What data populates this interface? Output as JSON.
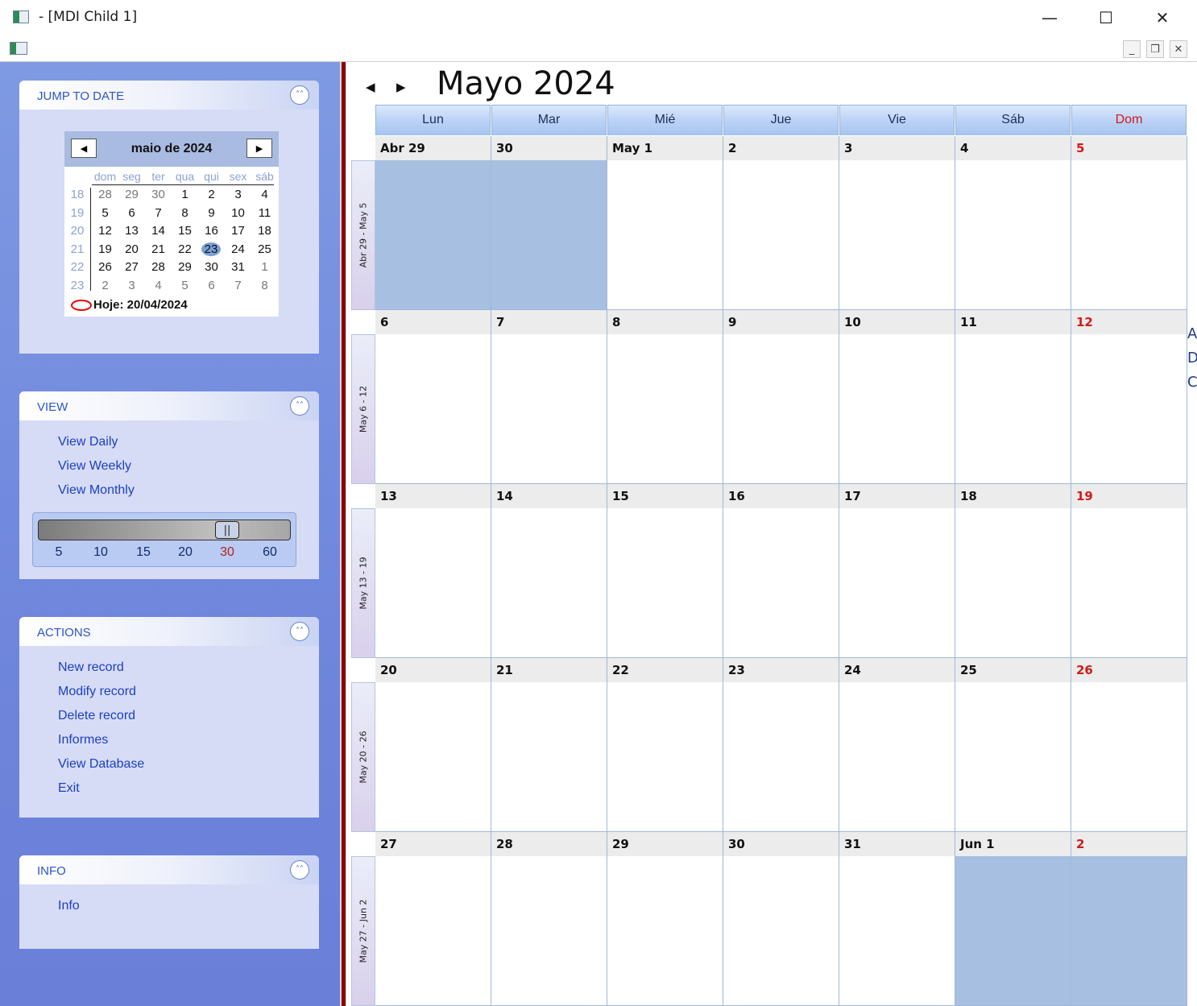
{
  "window": {
    "title": " - [MDI Child 1]",
    "minimize_icon": "—",
    "maximize_icon": "☐",
    "close_icon": "✕"
  },
  "mdi": {
    "min": "_",
    "restore": "❒",
    "close": "✕"
  },
  "sidebar": {
    "jump": {
      "title": "JUMP TO DATE",
      "collapse_icon": "˄˄",
      "minical": {
        "title": "maio de 2024",
        "prev": "◀",
        "next": "▶",
        "dow": [
          "dom",
          "seg",
          "ter",
          "qua",
          "qui",
          "sex",
          "sáb"
        ],
        "weeks": [
          {
            "wk": "18",
            "days": [
              "28",
              "29",
              "30",
              "1",
              "2",
              "3",
              "4"
            ]
          },
          {
            "wk": "19",
            "days": [
              "5",
              "6",
              "7",
              "8",
              "9",
              "10",
              "11"
            ]
          },
          {
            "wk": "20",
            "days": [
              "12",
              "13",
              "14",
              "15",
              "16",
              "17",
              "18"
            ]
          },
          {
            "wk": "21",
            "days": [
              "19",
              "20",
              "21",
              "22",
              "23",
              "24",
              "25"
            ]
          },
          {
            "wk": "22",
            "days": [
              "26",
              "27",
              "28",
              "29",
              "30",
              "31",
              "1"
            ]
          },
          {
            "wk": "23",
            "days": [
              "2",
              "3",
              "4",
              "5",
              "6",
              "7",
              "8"
            ]
          }
        ],
        "selected": "23",
        "today": "Hoje: 20/04/2024"
      }
    },
    "view": {
      "title": "VIEW",
      "links": [
        "View Daily",
        "View Weekly",
        "View Monthly"
      ],
      "slider": {
        "labels": [
          "5",
          "10",
          "15",
          "20",
          "30",
          "60"
        ],
        "value": "30",
        "highlight_color": "#b22222",
        "thumb": "||"
      }
    },
    "actions": {
      "title": "ACTIONS",
      "links": [
        "New record",
        "Modify record",
        "Delete record",
        "Informes",
        "View Database",
        "Exit"
      ]
    },
    "info": {
      "title": "INFO",
      "links": [
        "Info"
      ]
    }
  },
  "calendar": {
    "nav_prev": "◀",
    "nav_next": "▶",
    "title": "Mayo  2024",
    "weekdays": [
      "Lun",
      "Mar",
      "Mié",
      "Jue",
      "Vie",
      "Sáb",
      "Dom"
    ],
    "weekend_color": "#d21a1a",
    "week_labels": [
      "Abr 29 - May 5",
      "May 6 - 12",
      "May 13 - 19",
      "May 20 - 26",
      "May 27 - Jun 2"
    ],
    "rows": [
      [
        "Abr 29",
        "30",
        "May  1",
        "2",
        "3",
        "4",
        "5"
      ],
      [
        "6",
        "7",
        "8",
        "9",
        "10",
        "11",
        "12"
      ],
      [
        "13",
        "14",
        "15",
        "16",
        "17",
        "18",
        "19"
      ],
      [
        "20",
        "21",
        "22",
        "23",
        "24",
        "25",
        "26"
      ],
      [
        "27",
        "28",
        "29",
        "30",
        "31",
        "Jun  1",
        "2"
      ]
    ],
    "edge_glyphs": [
      "A",
      "D",
      "C"
    ]
  }
}
